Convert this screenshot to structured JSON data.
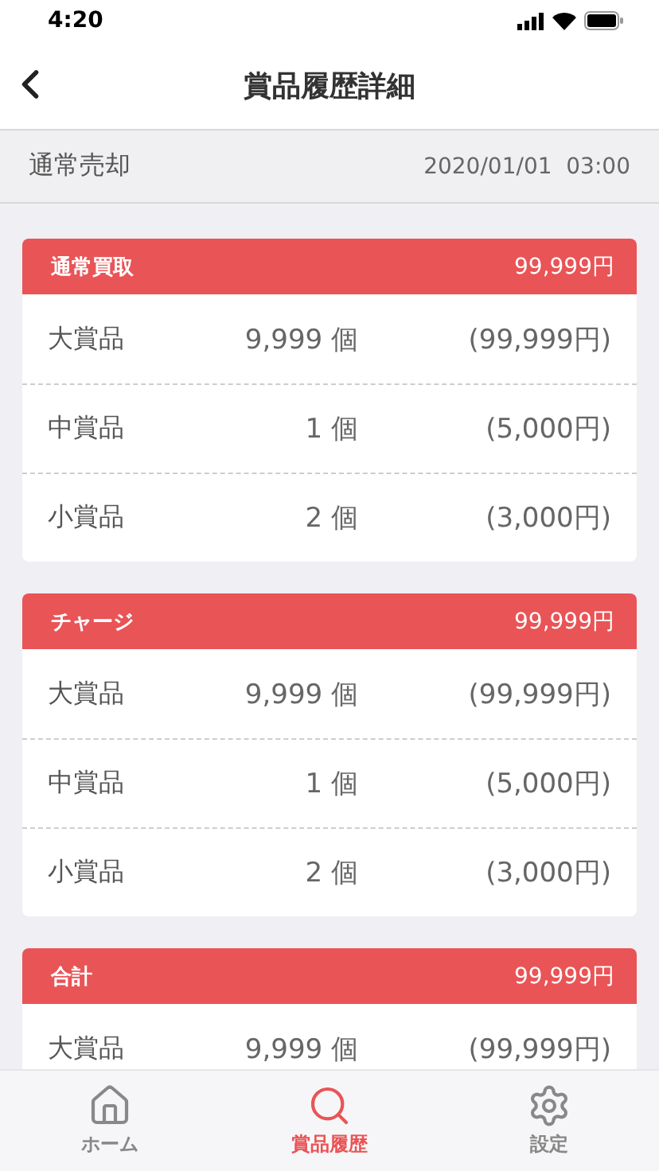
{
  "status_bar": {
    "time": "4:20"
  },
  "nav": {
    "title": "賞品履歴詳細"
  },
  "summary": {
    "label": "通常売却",
    "datetime": "2020/01/01  03:00"
  },
  "sections": [
    {
      "title": "通常買取",
      "total": "99,999円",
      "rows": [
        {
          "name": "大賞品",
          "count": "9,999 個",
          "amount": "(99,999円)"
        },
        {
          "name": "中賞品",
          "count": "1 個",
          "amount": "(5,000円)"
        },
        {
          "name": "小賞品",
          "count": "2 個",
          "amount": "(3,000円)"
        }
      ]
    },
    {
      "title": "チャージ",
      "total": "99,999円",
      "rows": [
        {
          "name": "大賞品",
          "count": "9,999 個",
          "amount": "(99,999円)"
        },
        {
          "name": "中賞品",
          "count": "1 個",
          "amount": "(5,000円)"
        },
        {
          "name": "小賞品",
          "count": "2 個",
          "amount": "(3,000円)"
        }
      ]
    },
    {
      "title": "合計",
      "total": "99,999円",
      "rows": [
        {
          "name": "大賞品",
          "count": "9,999 個",
          "amount": "(99,999円)"
        }
      ]
    }
  ],
  "tab_bar": [
    {
      "kind": "home",
      "label": "ホーム",
      "selected": false
    },
    {
      "kind": "search",
      "label": "賞品履歴",
      "selected": true
    },
    {
      "kind": "settings",
      "label": "設定",
      "selected": false
    }
  ]
}
